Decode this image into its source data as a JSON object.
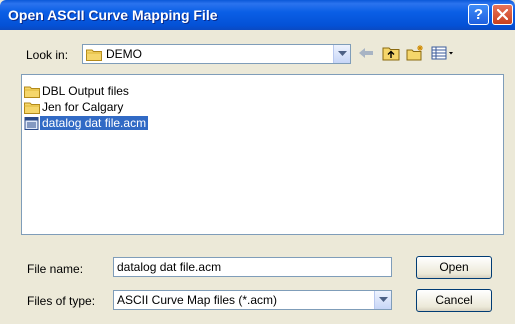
{
  "window": {
    "title": "Open ASCII Curve Mapping File",
    "help_label": "?"
  },
  "lookin": {
    "label": "Look in:",
    "value": "DEMO"
  },
  "files": [
    {
      "name": "DBL Output files",
      "type": "folder"
    },
    {
      "name": "Jen for Calgary",
      "type": "folder"
    },
    {
      "name": "datalog dat file.acm",
      "type": "file",
      "selected": true
    }
  ],
  "filename": {
    "label": "File name:",
    "value": "datalog dat file.acm"
  },
  "filetype": {
    "label": "Files of type:",
    "value": "ASCII Curve Map files (*.acm)"
  },
  "buttons": {
    "open": "Open",
    "cancel": "Cancel"
  },
  "icons": {
    "back": "back-arrow-icon",
    "up": "up-folder-icon",
    "new_folder": "new-folder-icon",
    "views": "views-menu-icon"
  },
  "colors": {
    "selection": "#316ac5",
    "titlebar": "#0a5fe6",
    "close": "#c8401e"
  }
}
